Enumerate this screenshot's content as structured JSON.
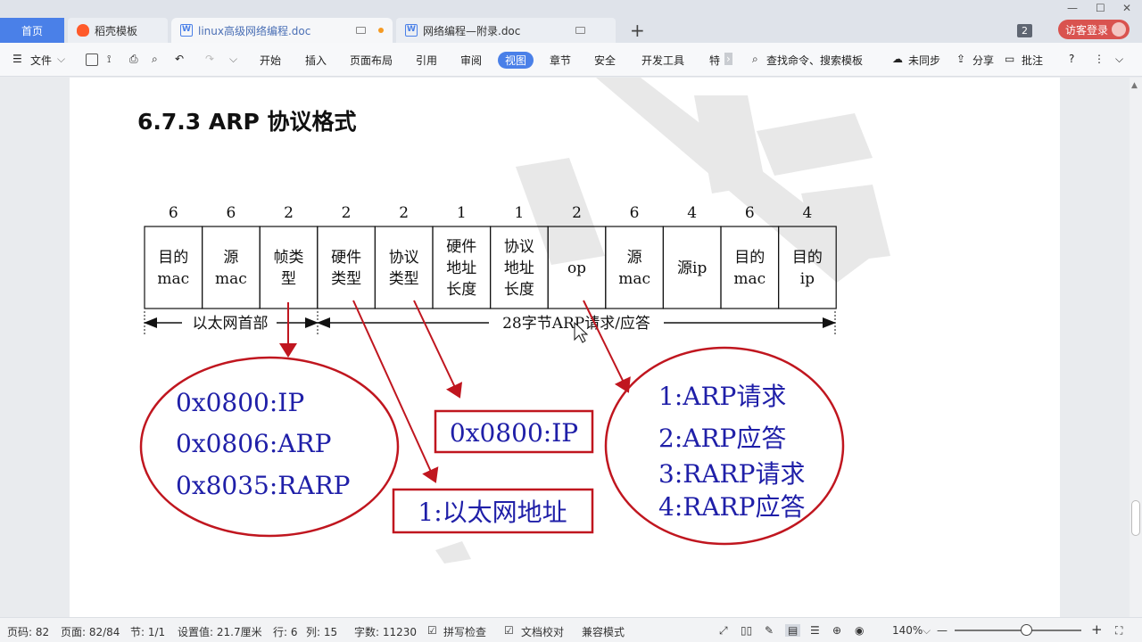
{
  "tabs": {
    "home": "首页",
    "t1": "稻壳模板",
    "t2": "linux高级网络编程.doc",
    "t3": "网络编程—附录.doc",
    "count": "2",
    "login": "访客登录"
  },
  "menu": {
    "file": "文件",
    "items": [
      "开始",
      "插入",
      "页面布局",
      "引用",
      "审阅",
      "视图",
      "章节",
      "安全",
      "开发工具",
      "特"
    ],
    "search": "查找命令、搜索模板",
    "sync": "未同步",
    "share": "分享",
    "comment": "批注"
  },
  "doc": {
    "heading": "6.7.3 ARP 协议格式",
    "diagram": {
      "sizes": [
        "6",
        "6",
        "2",
        "2",
        "2",
        "1",
        "1",
        "2",
        "6",
        "4",
        "6",
        "4"
      ],
      "fields": [
        [
          "目的",
          "mac"
        ],
        [
          "源",
          "mac"
        ],
        [
          "帧类",
          "型"
        ],
        [
          "硬件",
          "类型"
        ],
        [
          "协议",
          "类型"
        ],
        [
          "硬件",
          "地址",
          "长度"
        ],
        [
          "协议",
          "地址",
          "长度"
        ],
        [
          "op"
        ],
        [
          "源",
          "mac"
        ],
        [
          "源ip"
        ],
        [
          "目的",
          "mac"
        ],
        [
          "目的",
          "ip"
        ]
      ],
      "span_eth": "以太网首部",
      "span_arp": "28字节ARP请求/应答",
      "left_ellipse": [
        "0x0800:IP",
        "0x0806:ARP",
        "0x8035:RARP"
      ],
      "box_protocol": "0x0800:IP",
      "box_hardware": "1:以太网地址",
      "right_ellipse": [
        "1:ARP请求",
        "2:ARP应答",
        "3:RARP请求",
        "4:RARP应答"
      ]
    }
  },
  "status": {
    "page_code": "页码: 82",
    "page": "页面: 82/84",
    "section": "节: 1/1",
    "setting": "设置值: 21.7厘米",
    "row": "行: 6",
    "col": "列: 15",
    "words": "字数: 11230",
    "spell": "拼写检查",
    "proof": "文档校对",
    "compat": "兼容模式",
    "zoom": "140%"
  },
  "colors": {
    "accent": "#4a80e8",
    "annotation_red": "#c0161f",
    "annotation_blue": "#1f1fa8"
  }
}
